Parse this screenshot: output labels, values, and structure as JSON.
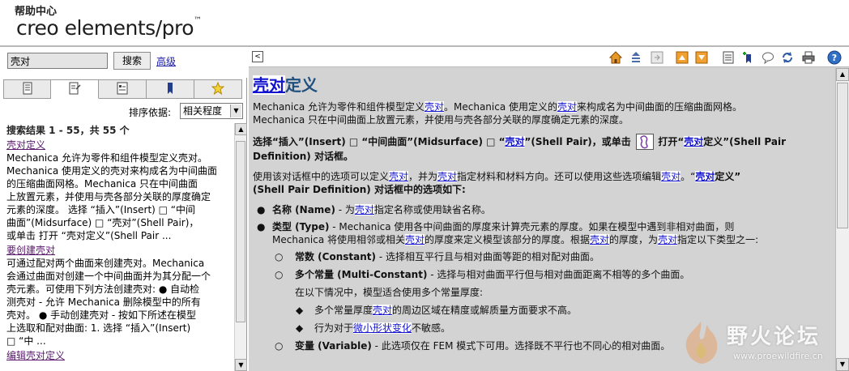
{
  "header": {
    "help_center": "帮助中心",
    "logo": "creo elements/pro",
    "logo_tm": "™"
  },
  "search": {
    "query": "壳对",
    "button_label": "搜索",
    "advanced_label": "高级"
  },
  "tabs": [
    {
      "icon": "contents-icon",
      "active": false
    },
    {
      "icon": "search-tab-icon",
      "active": true
    },
    {
      "icon": "index-icon",
      "active": false
    },
    {
      "icon": "bookmark-icon",
      "active": false
    },
    {
      "icon": "favorites-star-icon",
      "active": false
    }
  ],
  "sort": {
    "label": "排序依据:",
    "value": "相关程度"
  },
  "results": {
    "header": "搜索结果 1 - 55，共 55 个",
    "items": [
      {
        "title_prefix": "壳对",
        "title_suffix": "定义",
        "lines": [
          "Mechanica 允许为零件和组件模型定义壳对。",
          "Mechanica 使用定义的壳对来构成名为中间曲面",
          "的压缩曲面网格。Mechanica 只在中间曲面",
          "上放置元素，并使用与壳各部分关联的厚度确定",
          "元素的深度。 选择 “插入”(Insert)  □ “中间",
          "曲面”(Midsurface)  □ “壳对”(Shell Pair)，",
          "或单击 打开 “壳对定义”(Shell Pair ..."
        ]
      },
      {
        "title_prefix": "要创建",
        "title_suffix": "壳对",
        "lines": [
          "可通过配对两个曲面来创建壳对。Mechanica",
          "会通过曲面对创建一个中间曲面并为其分配一个",
          "壳元素。可使用下列方法创建壳对: ●  自动检",
          "测壳对 - 允许 Mechanica 删除模型中的所有",
          "壳对。 ●  手动创建壳对 - 按如下所述在模型",
          "上选取和配对曲面: 1. 选择 “插入”(Insert)",
          "□ “中 ..."
        ]
      },
      {
        "title_prefix": "编辑",
        "title_suffix": "壳对定义",
        "lines": []
      }
    ]
  },
  "toolbar": {
    "collapse_icon": "collapse-left-icon",
    "icons": [
      "home-icon",
      "sync-toc-icon",
      "next-page-icon",
      "prev-topic-icon",
      "next-topic-icon",
      "print-topic-icon",
      "add-bookmark-icon",
      "comment-icon",
      "refresh-icon",
      "print-icon",
      "help-icon"
    ]
  },
  "article": {
    "title_highlight": "壳对",
    "title_rest": "定义",
    "p1_a": "Mechanica 允许为零件和组件模型定义",
    "p1_b": "壳对",
    "p1_c": "。Mechanica 使用定义的",
    "p1_d": "壳对",
    "p1_e": "来构成名为中间曲面的压缩曲面网格。",
    "p1_f": "Mechanica 只在中间曲面上放置元素，并使用与壳各部分关联的厚度确定元素的深度。",
    "p2_a": "选择“插入”(Insert) □ “中间曲面”(Midsurface) □ “",
    "p2_b": "壳对",
    "p2_c": "”(Shell Pair)，或单击",
    "p2_d": "打开“",
    "p2_e": "壳对",
    "p2_f": "定义”(Shell Pair",
    "p2_g": "Definition) 对话框。",
    "p3_a": "使用该对话框中的选项可以定义",
    "p3_b": "壳对",
    "p3_c": "，并为",
    "p3_d": "壳对",
    "p3_e": "指定材料和材料方向。还可以使用这些选项编辑",
    "p3_f": "壳对",
    "p3_g": "。“",
    "p3_h": "壳对",
    "p3_i": "定义”",
    "p3_j": "(Shell Pair Definition) 对话框中的选项如下:",
    "b1_label": "名称 (Name)",
    "b1_a": " - 为",
    "b1_b": "壳对",
    "b1_c": "指定名称或使用缺省名称。",
    "b2_label": "类型 (Type)",
    "b2_a": " - Mechanica 使用各中间曲面的厚度来计算壳元素的厚度。如果在模型中遇到非相对曲面，则",
    "b2_b": "Mechanica 将使用相邻或相关",
    "b2_c": "壳对",
    "b2_d": "的厚度来定义模型该部分的厚度。根据",
    "b2_e": "壳对",
    "b2_f": "的厚度，为",
    "b2_g": "壳对",
    "b2_h": "指定以下类型之一:",
    "s1_label": "常数 (Constant)",
    "s1_text": " - 选择相互平行且与相对曲面等距的相对配对曲面。",
    "s2_label": "多个常量 (Multi-Constant)",
    "s2_text": " - 选择与相对曲面平行但与相对曲面距离不相等的多个曲面。",
    "s2_note": "在以下情况中，模型适合使用多个常量厚度:",
    "ss1_a": "多个常量厚度",
    "ss1_b": "壳对",
    "ss1_c": "的周边区域在精度或解质量方面要求不高。",
    "ss2_a": "行为对于",
    "ss2_b": "微小形状变化",
    "ss2_c": "不敏感。",
    "s3_label": "变量 (Variable)",
    "s3_text": " - 此选项仅在 FEM 模式下可用。选择既不平行也不同心的相对曲面。"
  },
  "watermark": {
    "title": "野火论坛",
    "url": "www.proewildfire.cn"
  }
}
